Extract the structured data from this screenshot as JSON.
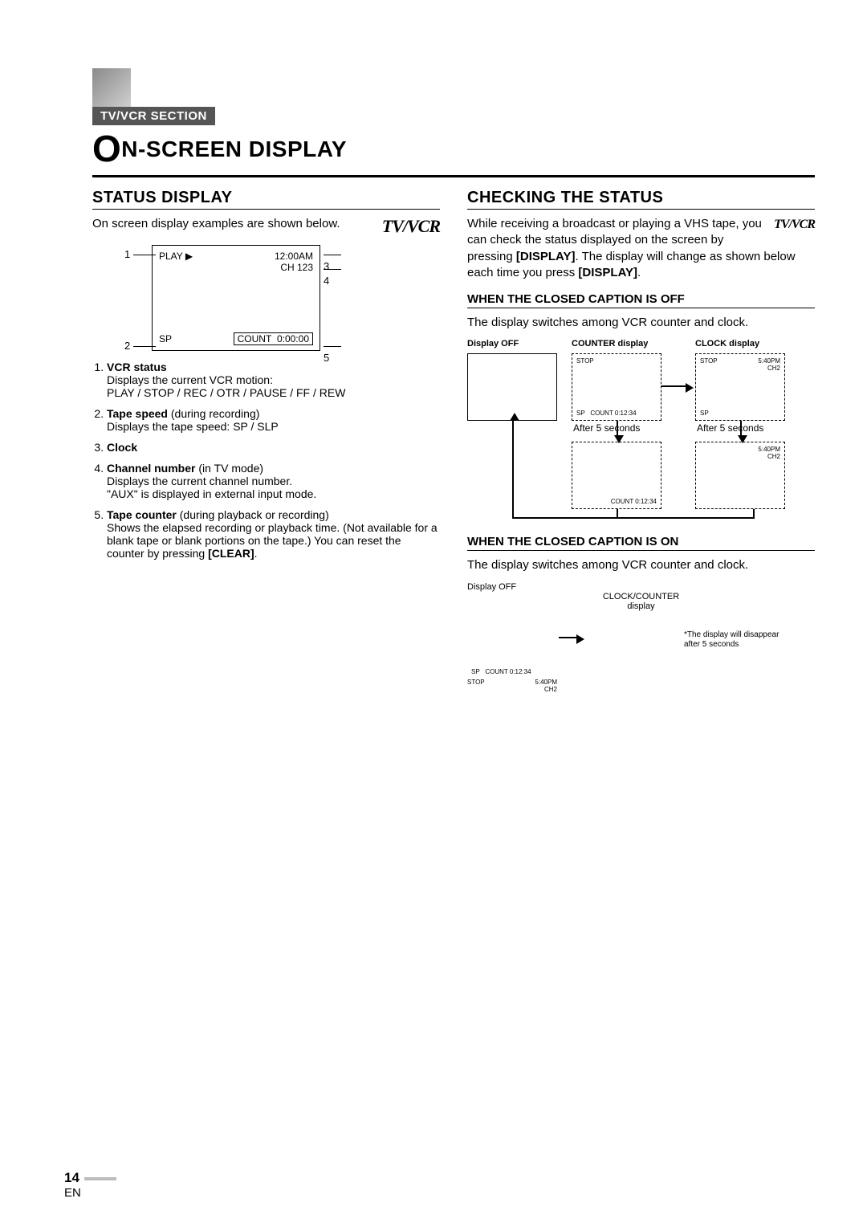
{
  "header": {
    "section_tag": "TV/VCR SECTION",
    "title_rest": "N-SCREEN DISPLAY"
  },
  "logo_text": "TV/VCR",
  "left": {
    "heading": "STATUS DISPLAY",
    "intro": "On screen display examples are shown below.",
    "osd": {
      "play": "PLAY",
      "time": "12:00AM",
      "ch": "CH  123",
      "sp": "SP",
      "count_label": "COUNT",
      "count_val": "0:00:00",
      "c1": "1",
      "c2": "2",
      "c3": "3",
      "c4": "4",
      "c5": "5"
    },
    "items": [
      {
        "title": "VCR status",
        "body": "Displays the current VCR motion:\nPLAY / STOP / REC / OTR / PAUSE / FF / REW"
      },
      {
        "title": "Tape speed",
        "note": "(during recording)",
        "body": "Displays the tape speed: SP / SLP"
      },
      {
        "title": "Clock",
        "body": ""
      },
      {
        "title": "Channel number",
        "note": "(in TV mode)",
        "body": "Displays the current channel number.\n\"AUX\" is displayed in external input mode."
      },
      {
        "title": "Tape counter",
        "note": "(during playback or recording)",
        "body": "Shows the elapsed recording or playback time. (Not available for a blank tape or blank portions on the tape.) You can reset the counter by pressing [CLEAR]."
      }
    ]
  },
  "right": {
    "heading": "CHECKING THE STATUS",
    "intro1": "While receiving a broadcast or playing a",
    "intro2": "VHS tape, you can check the status displayed on the screen by pressing ",
    "intro_btn1": "[DISPLAY]",
    "intro3": ". The display will change as shown below each time you press ",
    "intro_btn2": "[DISPLAY]",
    "intro4": ".",
    "sub1": "WHEN THE CLOSED CAPTION IS OFF",
    "sub1_body": "The display switches among VCR counter and clock.",
    "labels": {
      "displayOff": "Display OFF",
      "counter": "COUNTER display",
      "clock": "CLOCK display",
      "after5": "After 5 seconds",
      "clockCounter": "CLOCK/COUNTER display"
    },
    "mini": {
      "stop": "STOP",
      "sp": "SP",
      "count": "COUNT  0:12:34",
      "time": "5:40PM",
      "ch": "CH2"
    },
    "sub2": "WHEN THE CLOSED CAPTION IS ON",
    "sub2_body": "The display switches among VCR counter and clock.",
    "footnote": "*The display will disappear after 5 seconds"
  },
  "footer": {
    "page": "14",
    "lang": "EN"
  }
}
